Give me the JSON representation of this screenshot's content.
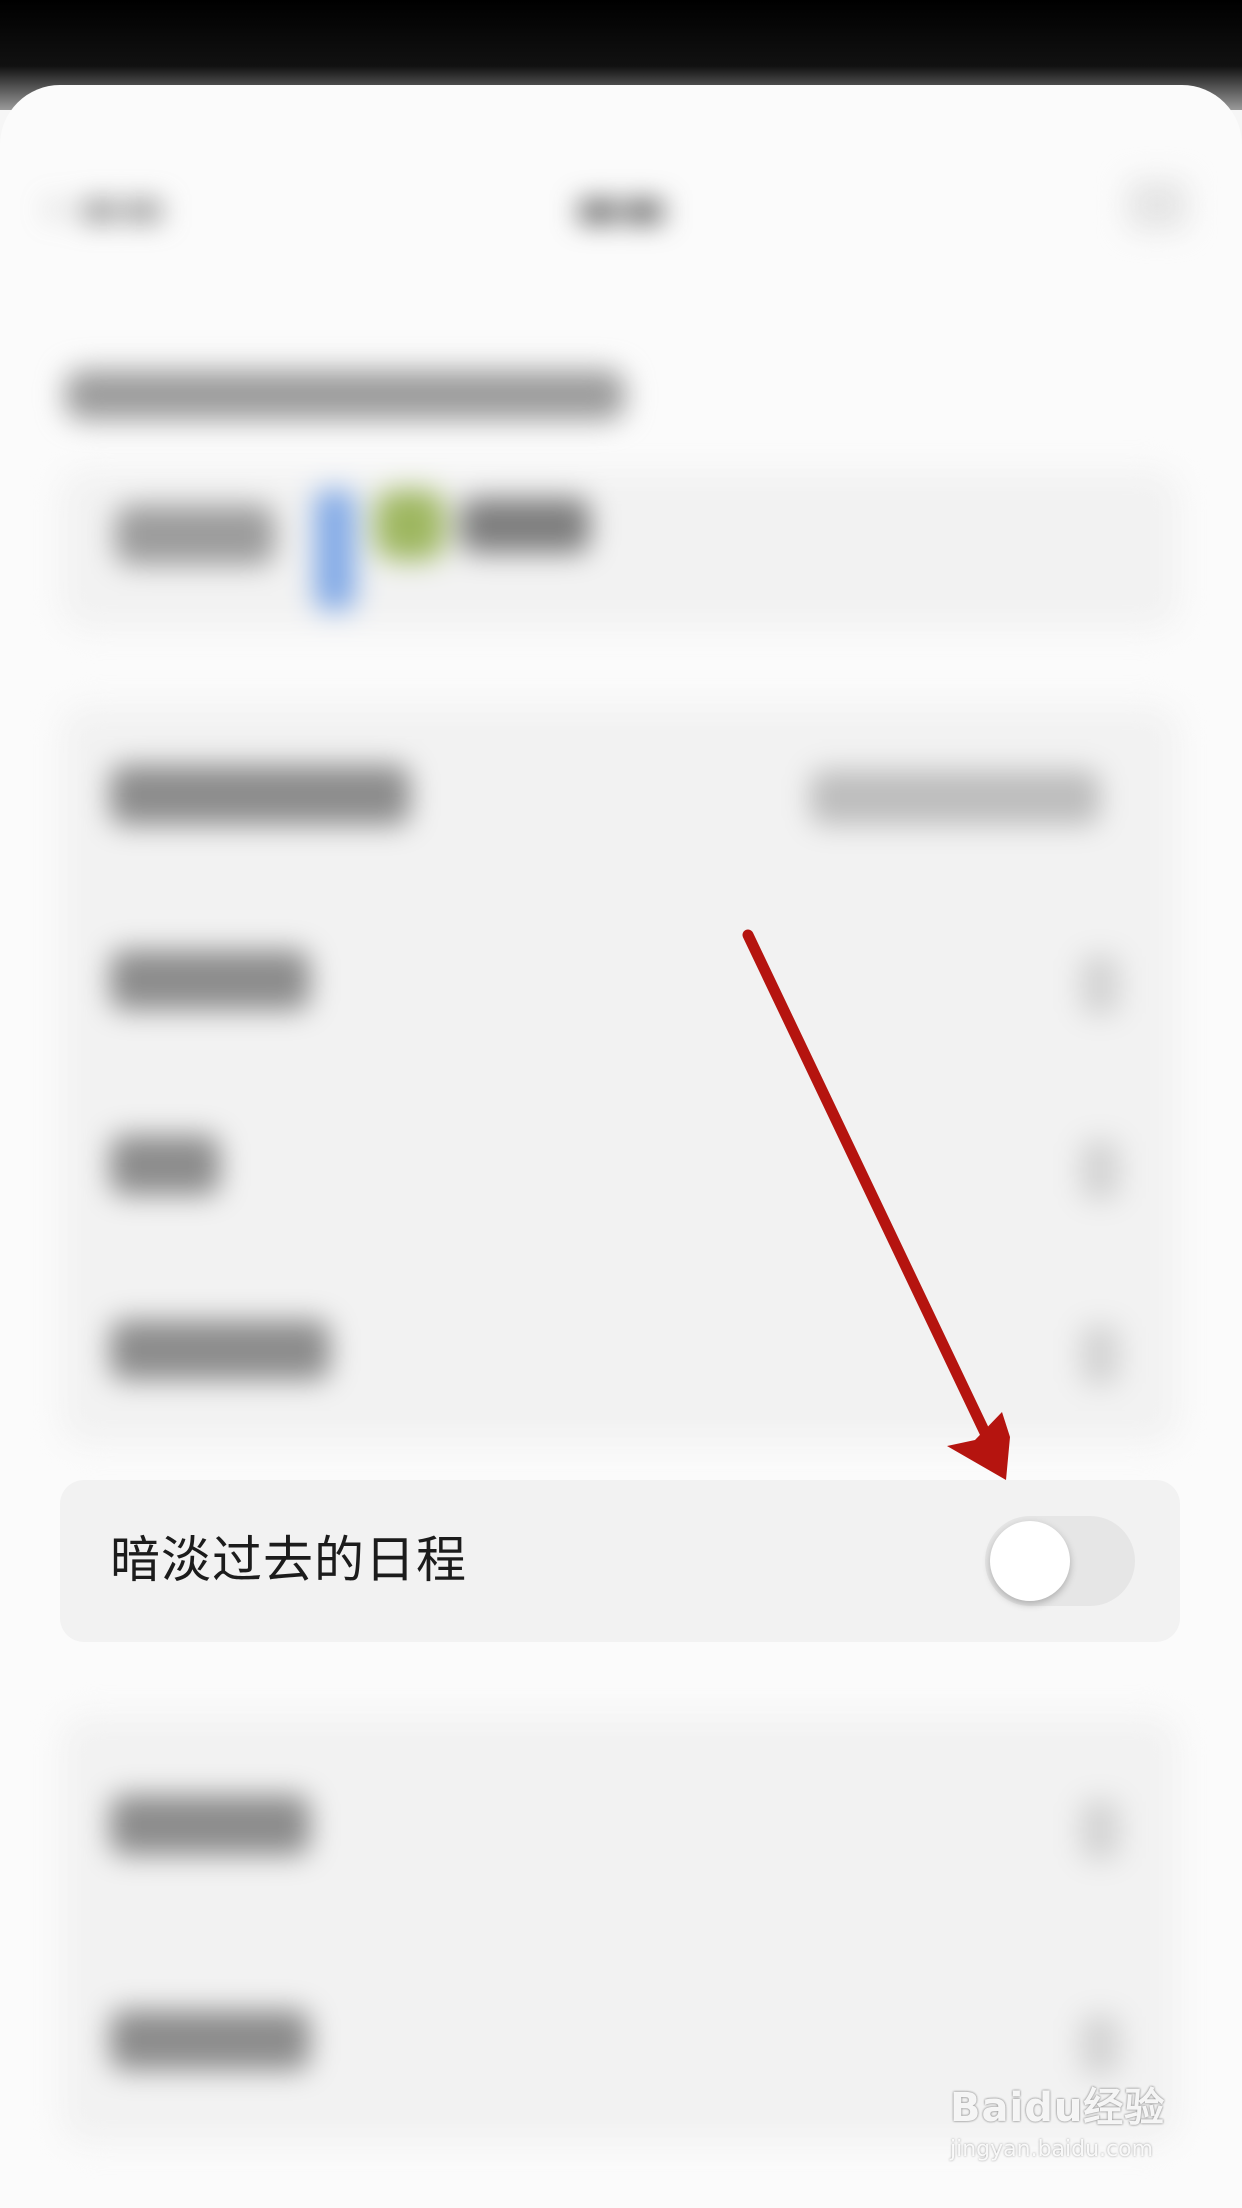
{
  "dim_past_events": {
    "label": "暗淡过去的日程",
    "toggle_on": false
  },
  "colors": {
    "arrow": "#b5140f",
    "toggle_track": "#e6e6e6",
    "card_background": "#f2f2f2"
  },
  "watermark": {
    "logo_text": "Baidu经验",
    "url_text": "jingyan.baidu.com"
  }
}
